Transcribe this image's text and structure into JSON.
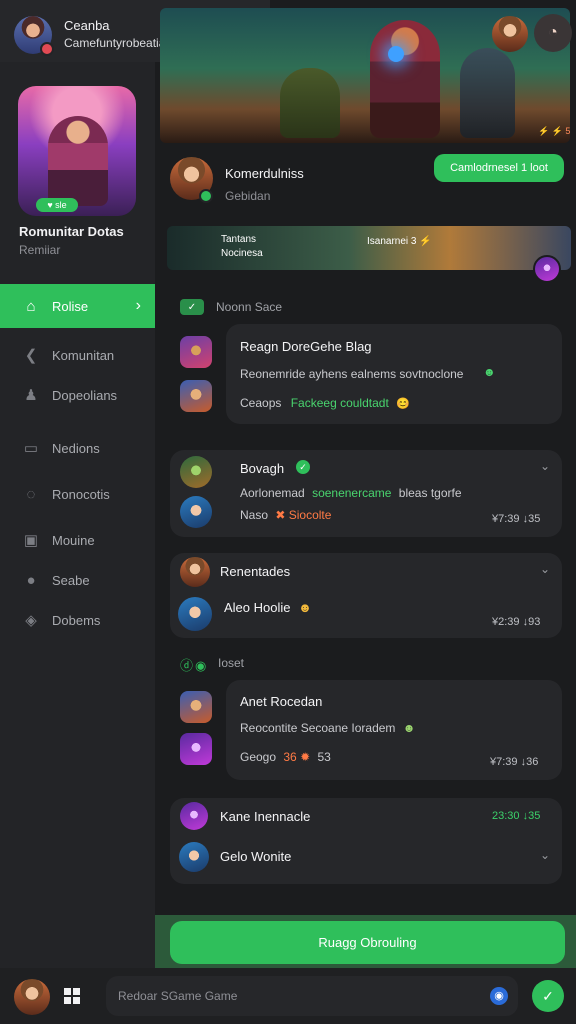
{
  "user": {
    "name": "Ceanba",
    "status": "Camefuntyrobeatiag!"
  },
  "sidebar": {
    "hero_title": "Romunitar Dotas",
    "hero_sub": "Remiiar",
    "hero_badge": "♥ sle",
    "items": [
      {
        "label": "Rolise",
        "icon": "house-icon",
        "active": true
      },
      {
        "label": "Komunitan",
        "icon": "back-arrow-icon"
      },
      {
        "label": "Dopeolians",
        "icon": "person-icon"
      },
      {
        "label": "Nedions",
        "icon": "window-icon"
      },
      {
        "label": "Ronocotis",
        "icon": "chat-bubble-icon"
      },
      {
        "label": "Mouine",
        "icon": "screen-icon"
      },
      {
        "label": "Seabe",
        "icon": "user-icon"
      },
      {
        "label": "Dobems",
        "icon": "tag-icon"
      }
    ]
  },
  "banner": {
    "tag": "⚡ ⚡ 5"
  },
  "profile": {
    "name": "Komerdulniss",
    "sub": "Gebidan",
    "action_label": "Camlodrnesel 1 loot"
  },
  "sub_banner": {
    "line1": "Tantans",
    "line2": "Nocinesa",
    "title": "Isanarnei 3 ⚡"
  },
  "section1": {
    "label": "Noonn Sace"
  },
  "section2": {
    "label": "Ioset"
  },
  "messages": [
    {
      "title": "Reagn DoreGehe Blag",
      "text": "Reonemride ayhens ealnems sovtnoclone",
      "line3_prefix": "Ceaops",
      "line3_highlight": "Fackeeg couldtadt",
      "emoji": "😊"
    },
    {
      "title": "Bovagh",
      "text_prefix": "Aorlonemad",
      "text_highlight": "soenenercame",
      "text_suffix": "bleas tgorfe",
      "line3_prefix": "Naso",
      "line3_highlight": "Siocolte",
      "time": "¥7:39 ↓35"
    },
    {
      "title": "Renentades",
      "line2": "Aleo Hoolie",
      "time": "¥2:39 ↓93"
    },
    {
      "title": "Anet Rocedan",
      "text": "Reocontite Secoane Ioradem",
      "line3": "Geogo",
      "line3_highlight": "36",
      "line3_suffix": "53",
      "time": "¥7:39 ↓36"
    },
    {
      "title": "Kane Inennacle",
      "line2": "Gelo Wonite",
      "time": "23:30 ↓35"
    }
  ],
  "cta": {
    "label": "Ruagg Obrouling"
  },
  "composer": {
    "placeholder": "Redoar SGame Game"
  }
}
